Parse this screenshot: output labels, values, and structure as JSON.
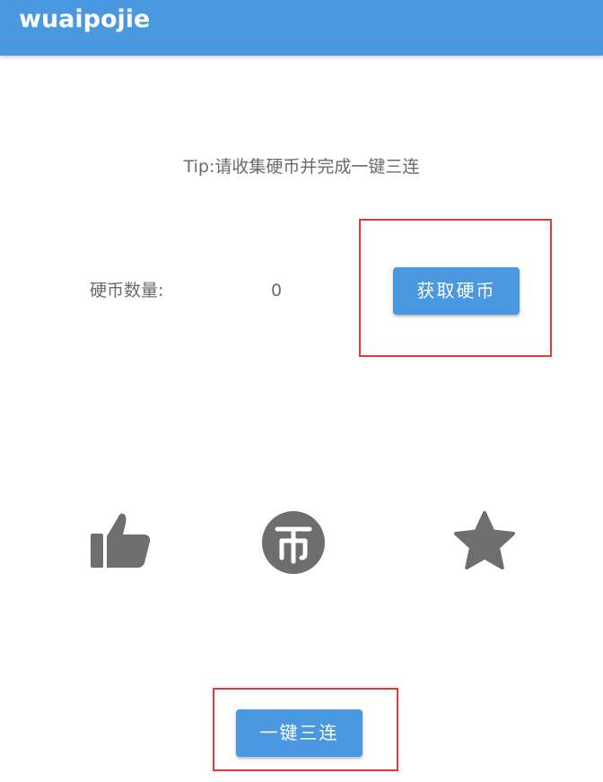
{
  "appbar": {
    "title": "wuaipojie",
    "color": "#4a98e0"
  },
  "tip": {
    "text": "Tip:请收集硬币并完成一键三连"
  },
  "coins": {
    "label": "硬币数量:",
    "value": "0"
  },
  "buttons": {
    "get_coin_label": "获取硬币",
    "triple_label": "一键三连"
  },
  "actions": {
    "like_icon": "thumbs-up-icon",
    "coin_icon": "coin-icon",
    "favorite_icon": "star-icon",
    "icon_color": "#6e6e6e"
  },
  "highlight_color": "#e53935"
}
